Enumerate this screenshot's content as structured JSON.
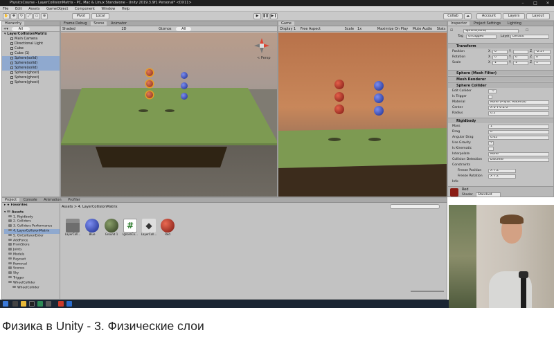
{
  "window": {
    "title": "PhysicsCourse - LayerCollisionMatrix - PC, Mac & Linux Standalone - Unity 2019.3.9f1 Personal* <DX11>"
  },
  "menu": [
    "File",
    "Edit",
    "Assets",
    "GameObject",
    "Component",
    "Window",
    "Help"
  ],
  "toolbar": {
    "pivot": "Pivot",
    "local": "Local",
    "collab": "Collab",
    "account": "Account",
    "layers": "Layers",
    "layout": "Layout"
  },
  "scene_panel": {
    "tabs": [
      "Frame Debug",
      "Scene",
      "Animator"
    ],
    "shading": "Shaded",
    "mode": "2D",
    "gizmos": "Gizmos",
    "search": "All",
    "persp": "< Persp"
  },
  "game_panel": {
    "tab": "Game",
    "display": "Display 1",
    "aspect": "Free Aspect",
    "scale": "Scale",
    "scale_value": "1x",
    "maximize": "Maximize On Play",
    "mute": "Mute Audio",
    "stats": "Stats"
  },
  "hierarchy": {
    "tab": "Hierarchy",
    "search": "All",
    "root": "LayerCollisionMatrix",
    "items": [
      {
        "label": "Main Camera",
        "sel": false
      },
      {
        "label": "Directional Light",
        "sel": false
      },
      {
        "label": "Cube",
        "sel": false
      },
      {
        "label": "Cube (1)",
        "sel": false
      },
      {
        "label": "Sphere(solid)",
        "sel": true
      },
      {
        "label": "Sphere(solid)",
        "sel": true
      },
      {
        "label": "Sphere(solid)",
        "sel": true
      },
      {
        "label": "Sphere(ghost)",
        "sel": false
      },
      {
        "label": "Sphere(ghost)",
        "sel": false
      },
      {
        "label": "Sphere(ghost)",
        "sel": false
      }
    ]
  },
  "project": {
    "tabs": [
      "Project",
      "Console",
      "Animation",
      "Profiler"
    ],
    "favorites": "Favorites",
    "assets_root": "Assets",
    "tree": [
      "1. Rigidbody",
      "2. Colliders",
      "3. Colliders Performance",
      "4. LayerCollisionMatrix",
      "5. OnCollisionEnter",
      "AddForce",
      "FromStore",
      "Joints",
      "Models",
      "Raycast",
      "Removal",
      "Scenes",
      "Sky",
      "Trigger",
      "WheelCollider",
      "WheelCollider"
    ],
    "breadcrumb": "Assets > 4. LayerCollisionMatrix",
    "assets": [
      {
        "label": "LayerColl...",
        "kind": "folder",
        "color": "#6e6e6e"
      },
      {
        "label": "Blue",
        "kind": "sphere",
        "color": "#3048b8"
      },
      {
        "label": "Ground 1",
        "kind": "sphere",
        "color": "#4c5c3a"
      },
      {
        "label": "IgnoreCo...",
        "kind": "script",
        "color": "#ffffff"
      },
      {
        "label": "LayerColl...",
        "kind": "unity",
        "color": "#dddddd"
      },
      {
        "label": "Red",
        "kind": "sphere",
        "color": "#b52a22"
      }
    ]
  },
  "inspector": {
    "tabs": [
      "Inspector",
      "Project Settings",
      "Lighting"
    ],
    "object_name": "Sphere(solid)",
    "tag_label": "Tag",
    "tag": "Untagged",
    "layer_label": "Layer",
    "layer": "Default",
    "transform": {
      "header": "Transform",
      "rows": [
        {
          "label": "Position",
          "x": "X",
          "x_val": "0",
          "y": "Y",
          "y_val": "",
          "z": "Z",
          "z_val": "-2.57"
        },
        {
          "label": "Rotation",
          "x": "X",
          "x_val": "0",
          "y": "Y",
          "y_val": "0",
          "z": "Z",
          "z_val": "0"
        },
        {
          "label": "Scale",
          "x": "X",
          "x_val": "1",
          "y": "Y",
          "y_val": "1",
          "z": "Z",
          "z_val": "1"
        }
      ]
    },
    "mesh_filter": "Sphere (Mesh Filter)",
    "mesh_renderer": "Mesh Renderer",
    "sphere_collider": {
      "header": "Sphere Collider",
      "rows": [
        {
          "label": "Edit Collider",
          "value": ""
        },
        {
          "label": "Is Trigger",
          "value": ""
        },
        {
          "label": "Material",
          "value": "None (Physic Material)"
        },
        {
          "label": "Center",
          "value": "X 0   Y 0   Z 0"
        },
        {
          "label": "Radius",
          "value": "0.5"
        }
      ]
    },
    "rigidbody": {
      "header": "Rigidbody",
      "rows": [
        {
          "label": "Mass",
          "value": "1"
        },
        {
          "label": "Drag",
          "value": "0"
        },
        {
          "label": "Angular Drag",
          "value": "0.05"
        },
        {
          "label": "Use Gravity",
          "value": "✓"
        },
        {
          "label": "Is Kinematic",
          "value": ""
        },
        {
          "label": "Interpolate",
          "value": "None"
        },
        {
          "label": "Collision Detection",
          "value": "Discrete"
        },
        {
          "label": "Constraints",
          "value": ""
        },
        {
          "label": "Freeze Position",
          "value": "X  Y  Z"
        },
        {
          "label": "Freeze Rotation",
          "value": "X  Y  Z"
        },
        {
          "label": "Info",
          "value": ""
        }
      ]
    },
    "material_name": "Red",
    "shader_label": "Shader",
    "shader": "Standard"
  },
  "caption": "Физика в Unity - 3. Физические слои",
  "colors": {
    "red_ball": "#b52a22",
    "blue_ball": "#2f45c6",
    "ground": "#7d9a52",
    "selection": "#8fa9cf"
  }
}
